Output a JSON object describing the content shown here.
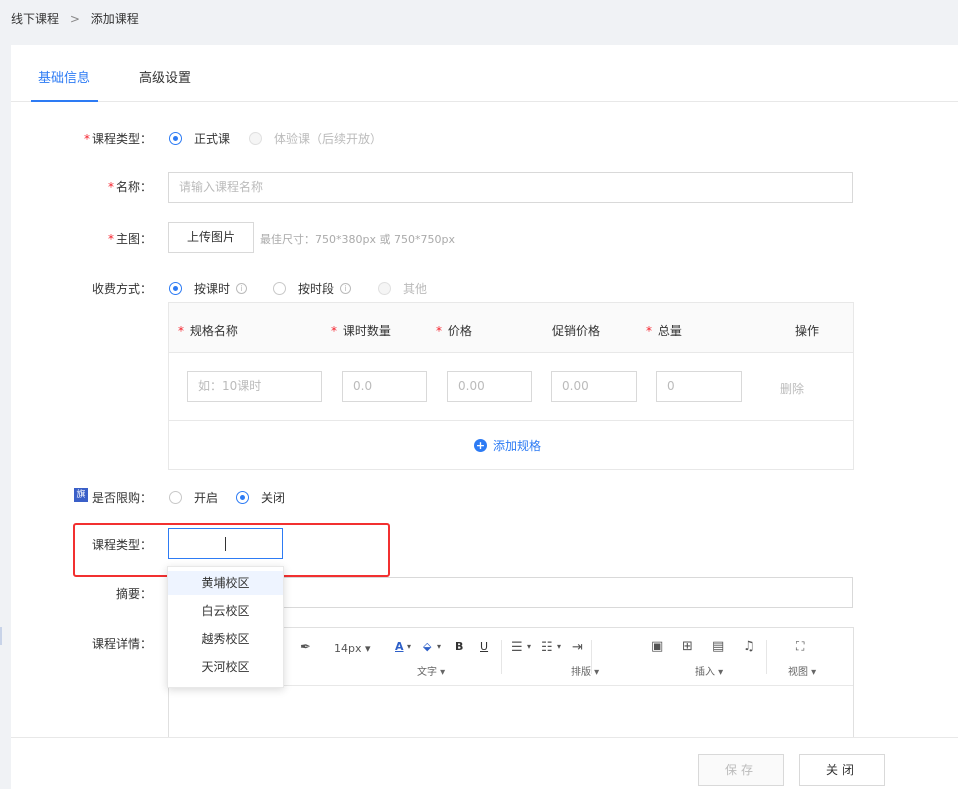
{
  "breadcrumb": {
    "parent": "线下课程",
    "separator": ">",
    "current": "添加课程"
  },
  "tabs": [
    {
      "label": "基础信息"
    },
    {
      "label": "高级设置"
    }
  ],
  "form": {
    "course_type": {
      "label": "课程类型：",
      "options": [
        {
          "label": "正式课",
          "selected": true
        },
        {
          "label": "体验课（后续开放）",
          "disabled": true
        }
      ]
    },
    "name": {
      "label": "名称：",
      "placeholder": "请输入课程名称"
    },
    "main_image": {
      "label": "主图：",
      "button": "上传图片",
      "hint": "最佳尺寸：750*380px 或 750*750px"
    },
    "charge_mode": {
      "label": "收费方式：",
      "options": [
        {
          "label": "按课时",
          "selected": true
        },
        {
          "label": "按时段"
        },
        {
          "label": "其他",
          "disabled": true
        }
      ]
    },
    "spec_table": {
      "headers": [
        "规格名称",
        "课时数量",
        "价格",
        "促销价格",
        "总量",
        "操作"
      ],
      "row": {
        "name_placeholder": "如：10课时",
        "hours": "0.0",
        "price": "0.00",
        "promo_price": "0.00",
        "total": "0",
        "action": "删除"
      },
      "add_label": "添加规格"
    },
    "purchase_limit": {
      "badge": "旗",
      "label": "是否限购：",
      "options": [
        {
          "label": "开启"
        },
        {
          "label": "关闭",
          "selected": true
        }
      ]
    },
    "course_category": {
      "label": "课程类型：",
      "dropdown": [
        "黄埔校区",
        "白云校区",
        "越秀校区",
        "天河校区"
      ]
    },
    "summary": {
      "label": "摘要："
    },
    "details": {
      "label": "课程详情：",
      "toolbar": {
        "font_size": "14px",
        "bold": "B",
        "underline": "U",
        "captions": {
          "text": "文字",
          "layout": "排版",
          "insert": "插入",
          "view": "视图"
        }
      }
    }
  },
  "footer": {
    "save": "保存",
    "close": "关闭"
  },
  "colors": {
    "accent": "#2d7bf4",
    "required": "#f5222d",
    "highlight": "#f23030"
  }
}
